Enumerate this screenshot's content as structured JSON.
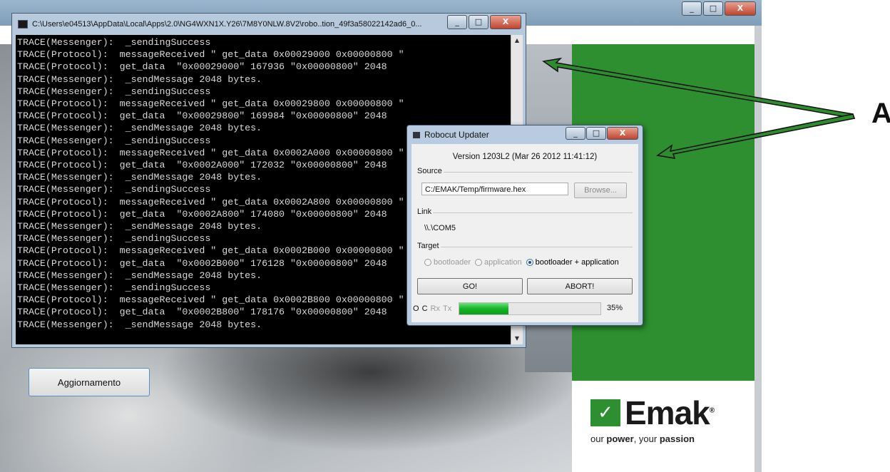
{
  "console": {
    "title": "C:\\Users\\e04513\\AppData\\Local\\Apps\\2.0\\NG4WXN1X.Y26\\7M8Y0NLW.8V2\\robo..tion_49f3a58022142ad6_0...",
    "lines": [
      "TRACE(Messenger):  _sendingSuccess",
      "TRACE(Protocol):  messageReceived \" get_data 0x00029000 0x00000800 \"",
      "TRACE(Protocol):  get_data  \"0x00029000\" 167936 \"0x00000800\" 2048",
      "TRACE(Messenger):  _sendMessage 2048 bytes.",
      "TRACE(Messenger):  _sendingSuccess",
      "TRACE(Protocol):  messageReceived \" get_data 0x00029800 0x00000800 \"",
      "TRACE(Protocol):  get_data  \"0x00029800\" 169984 \"0x00000800\" 2048",
      "TRACE(Messenger):  _sendMessage 2048 bytes.",
      "TRACE(Messenger):  _sendingSuccess",
      "TRACE(Protocol):  messageReceived \" get_data 0x0002A000 0x00000800 \"",
      "TRACE(Protocol):  get_data  \"0x0002A000\" 172032 \"0x00000800\" 2048",
      "TRACE(Messenger):  _sendMessage 2048 bytes.",
      "TRACE(Messenger):  _sendingSuccess",
      "TRACE(Protocol):  messageReceived \" get_data 0x0002A800 0x00000800 \"",
      "TRACE(Protocol):  get_data  \"0x0002A800\" 174080 \"0x00000800\" 2048",
      "TRACE(Messenger):  _sendMessage 2048 bytes.",
      "TRACE(Messenger):  _sendingSuccess",
      "TRACE(Protocol):  messageReceived \" get_data 0x0002B000 0x00000800 \"",
      "TRACE(Protocol):  get_data  \"0x0002B000\" 176128 \"0x00000800\" 2048",
      "TRACE(Messenger):  _sendMessage 2048 bytes.",
      "TRACE(Messenger):  _sendingSuccess",
      "TRACE(Protocol):  messageReceived \" get_data 0x0002B800 0x00000800 \"",
      "TRACE(Protocol):  get_data  \"0x0002B800\" 178176 \"0x00000800\" 2048",
      "TRACE(Messenger):  _sendMessage 2048 bytes."
    ]
  },
  "window_controls": {
    "minimize": "_",
    "maximize": "□",
    "close": "X"
  },
  "updater": {
    "title": "Robocut Updater",
    "version": "Version 1203L2 (Mar 26 2012 11:41:12)",
    "source_label": "Source",
    "source_value": "C:/EMAK/Temp/firmware.hex",
    "browse_label": "Browse...",
    "link_label": "Link",
    "link_value": "\\\\.\\COM5",
    "target_label": "Target",
    "targets": [
      {
        "label": "bootloader",
        "selected": false,
        "enabled": false
      },
      {
        "label": "application",
        "selected": false,
        "enabled": false
      },
      {
        "label": "bootloader + application",
        "selected": true,
        "enabled": true
      }
    ],
    "go_label": "GO!",
    "abort_label": "ABORT!",
    "indicators": {
      "o": "O",
      "c": "C",
      "rx": "Rx",
      "tx": "Tx"
    },
    "progress_percent": 35,
    "progress_text": "35%"
  },
  "main_app": {
    "update_button": "Aggiornamento",
    "logo_text": "Emak",
    "tagline_our": "our ",
    "tagline_power": "power",
    "tagline_mid": ", your ",
    "tagline_passion": "passion",
    "registered": "®"
  },
  "annotation": {
    "label": "A",
    "color": "#2e8b2e"
  }
}
